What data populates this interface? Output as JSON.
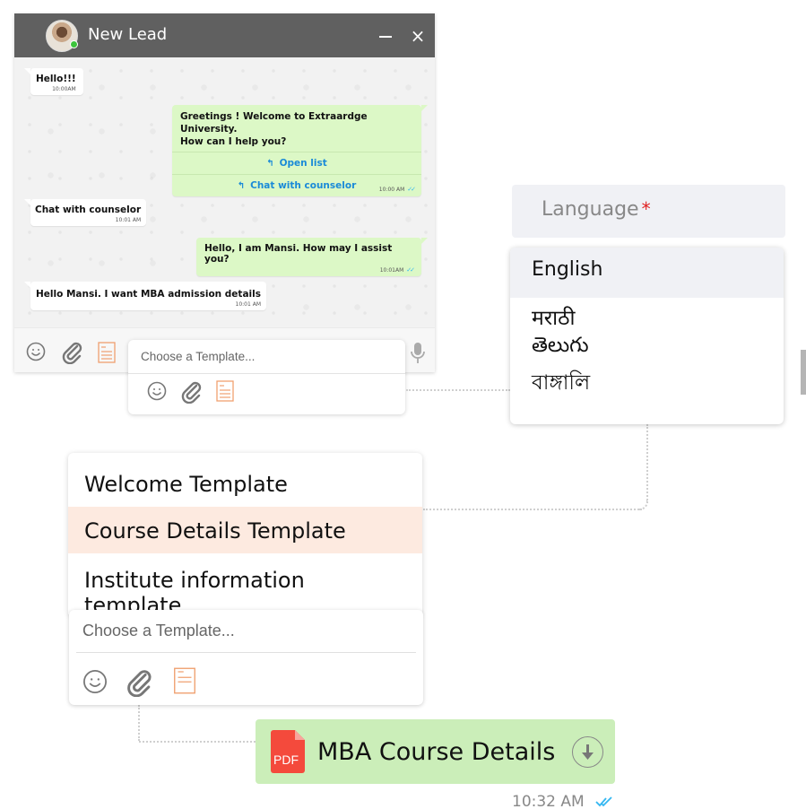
{
  "chat": {
    "title": "New Lead",
    "minimize_label": "",
    "close_label": "×",
    "messages": [
      {
        "direction": "in",
        "text": "Hello!!!",
        "time": "10:00AM"
      },
      {
        "direction": "out",
        "text_line1": "Greetings !  Welcome to Extraardge University.",
        "text_line2": "How can I help you?",
        "quick_replies": [
          "Open list",
          "Chat with counselor"
        ],
        "time": "10:00 AM",
        "status": "read"
      },
      {
        "direction": "in",
        "text": "Chat with counselor",
        "time": "10:01 AM"
      },
      {
        "direction": "out",
        "text": "Hello, I am Mansi. How may I assist you?",
        "time": "10:01AM",
        "status": "read"
      },
      {
        "direction": "in",
        "text": "Hello Mansi. I want MBA admission details",
        "time": "10:01 AM"
      }
    ],
    "footer_icons": [
      "emoji-icon",
      "attachment-icon",
      "template-icon",
      "microphone-icon"
    ]
  },
  "composer_small": {
    "placeholder": "Choose a Template..."
  },
  "language": {
    "label": "Language",
    "required_mark": "*",
    "options": [
      "English",
      "मराठी",
      "తెలుగు",
      "বাঙ্গালি"
    ],
    "selected": "English"
  },
  "templates": {
    "options": [
      "Welcome Template",
      "Course Details Template",
      "Institute information template"
    ],
    "highlighted": "Course Details Template"
  },
  "composer_big": {
    "placeholder": "Choose a Template..."
  },
  "document": {
    "type_label": "PDF",
    "name": "MBA Course Details",
    "time": "10:32 AM",
    "status": "read"
  },
  "colors": {
    "header_bg": "#606060",
    "outgoing_bubble": "#dcf8c6",
    "link_blue": "#1a8ad8",
    "template_highlight": "#fdeae0",
    "template_icon_orange": "#f0a070",
    "pdf_red": "#f44a3c",
    "pdf_bubble": "#cbeeb9",
    "required_red": "#e02020",
    "read_tick_blue": "#34b7f1"
  }
}
